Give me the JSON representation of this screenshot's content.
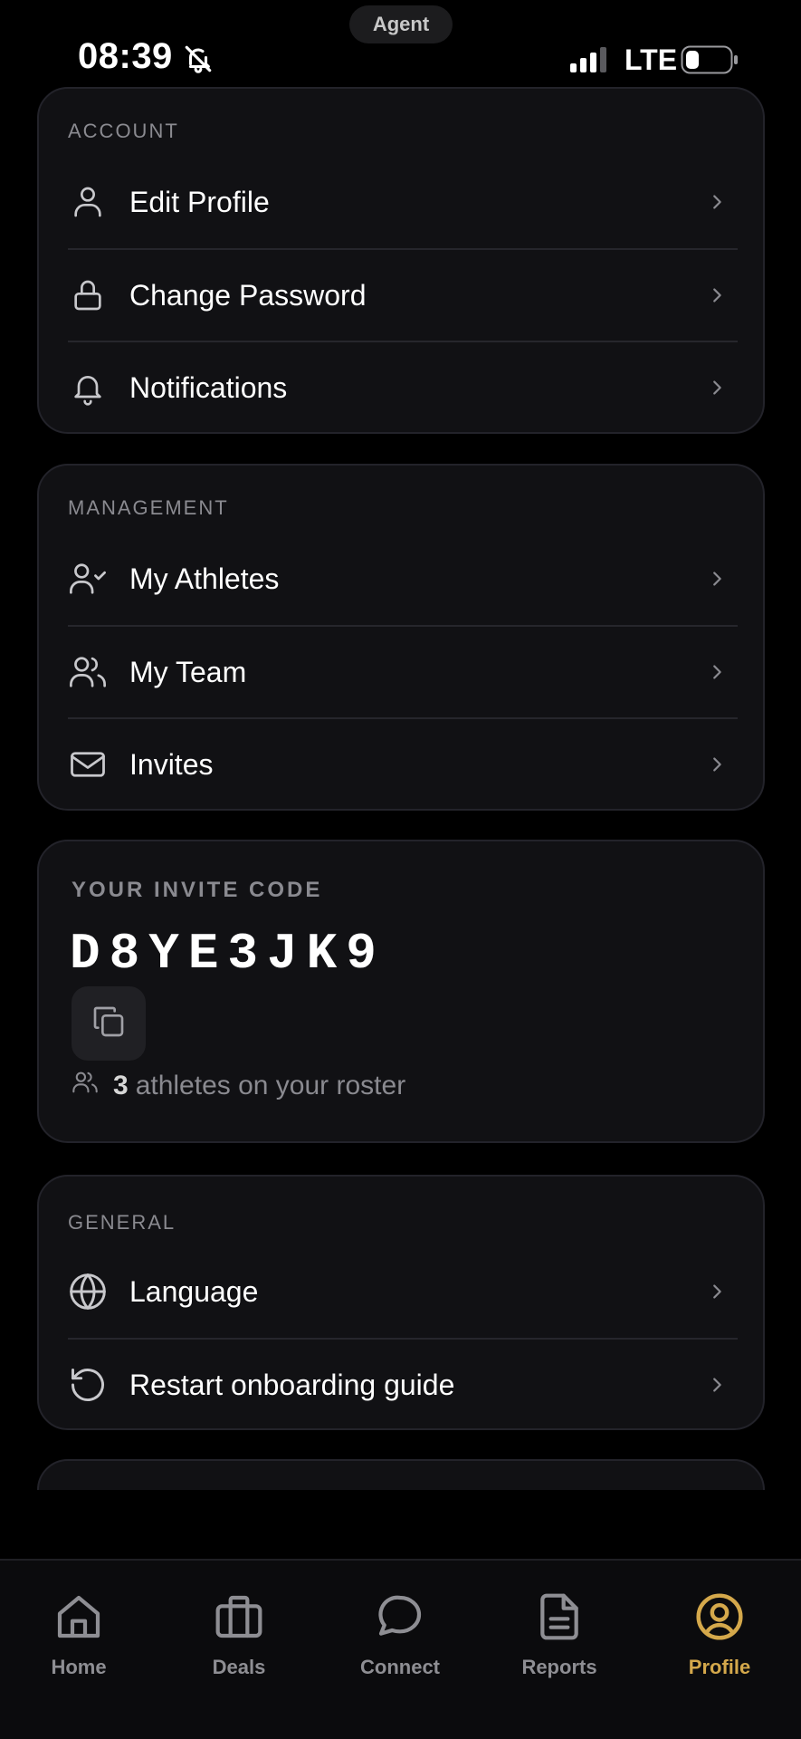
{
  "status_bar": {
    "agent_label": "Agent",
    "time": "08:39",
    "network": "LTE"
  },
  "account": {
    "title": "ACCOUNT",
    "items": [
      {
        "label": "Edit Profile",
        "icon": "user-icon"
      },
      {
        "label": "Change Password",
        "icon": "lock-icon"
      },
      {
        "label": "Notifications",
        "icon": "bell-icon"
      }
    ]
  },
  "management": {
    "title": "MANAGEMENT",
    "items": [
      {
        "label": "My Athletes",
        "icon": "user-check-icon"
      },
      {
        "label": "My Team",
        "icon": "users-icon"
      },
      {
        "label": "Invites",
        "icon": "mail-icon"
      }
    ]
  },
  "invite": {
    "title": "YOUR INVITE CODE",
    "code": "D8YE3JK9",
    "roster_count": "3",
    "roster_text": "athletes on your roster"
  },
  "general": {
    "title": "GENERAL",
    "items": [
      {
        "label": "Language",
        "icon": "globe-icon"
      },
      {
        "label": "Restart onboarding guide",
        "icon": "restart-icon"
      }
    ]
  },
  "tabbar": {
    "active": "Profile",
    "active_color": "#d4a84b",
    "items": [
      {
        "label": "Home",
        "icon": "home-icon"
      },
      {
        "label": "Deals",
        "icon": "briefcase-icon"
      },
      {
        "label": "Connect",
        "icon": "chat-icon"
      },
      {
        "label": "Reports",
        "icon": "document-icon"
      },
      {
        "label": "Profile",
        "icon": "profile-circle-icon"
      }
    ]
  }
}
